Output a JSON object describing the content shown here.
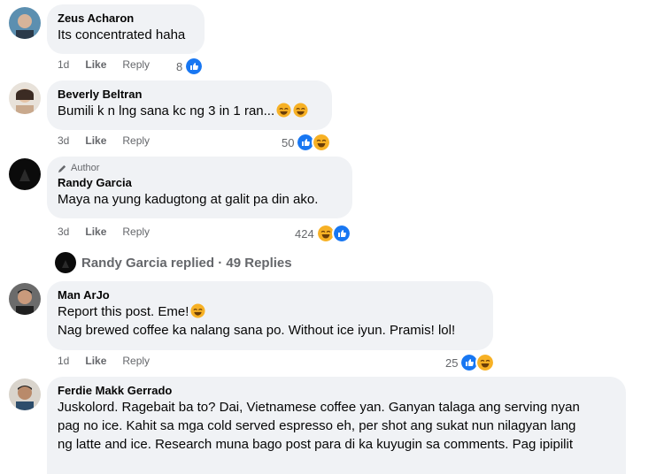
{
  "comments": [
    {
      "name": "Zeus Acharon",
      "text": [
        "Its concentrated haha"
      ],
      "time": "1d",
      "like": "Like",
      "reply": "Reply",
      "reactions": "8"
    },
    {
      "name": "Beverly Beltran",
      "text": [
        "Bumili k n lng sana kc ng 3 in 1 ran..."
      ],
      "time": "3d",
      "like": "Like",
      "reply": "Reply",
      "reactions": "50"
    },
    {
      "name": "Randy Garcia",
      "author_label": "Author",
      "text": [
        "Maya na yung kadugtong at galit pa din ako."
      ],
      "time": "3d",
      "like": "Like",
      "reply": "Reply",
      "reactions": "424"
    },
    {
      "name": "Man ArJo",
      "text": [
        "Report this post. Eme!",
        "Nag brewed coffee ka nalang sana po. Without ice iyun. Pramis! lol!"
      ],
      "time": "1d",
      "like": "Like",
      "reply": "Reply",
      "reactions": "25"
    },
    {
      "name": "Ferdie Makk Gerrado",
      "text": [
        "Juskolord. Ragebait ba to? Dai, Vietnamese coffee yan. Ganyan talaga ang serving nyan",
        "pag no ice. Kahit sa mga cold served espresso eh, per shot ang sukat nun nilagyan lang",
        "ng latte and ice. Research muna bago post para di ka kuyugin sa comments. Pag ipipilit"
      ]
    }
  ],
  "replies_link": {
    "text": "Randy Garcia replied · 49 Replies"
  },
  "colors": {
    "like_blue": "#1877f2",
    "haha_yellow": "#f7b125",
    "bubble": "#f0f2f5",
    "meta": "#65676b"
  }
}
